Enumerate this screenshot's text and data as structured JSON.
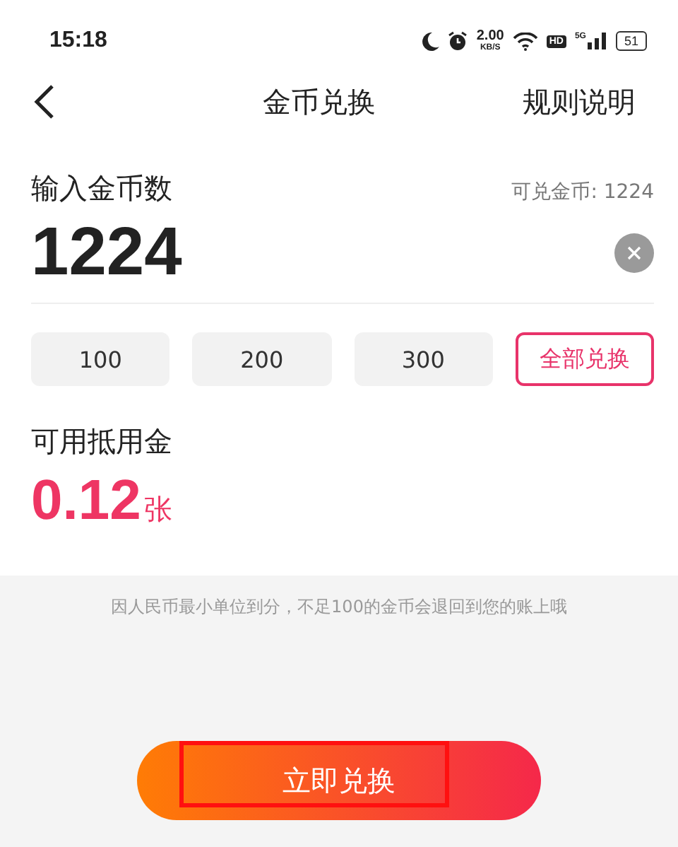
{
  "status_bar": {
    "time": "15:18",
    "speed_value": "2.00",
    "speed_unit": "KB/S",
    "hd": "HD",
    "network": "5G",
    "battery": "51"
  },
  "nav": {
    "title": "金币兑换",
    "action": "规则说明"
  },
  "input": {
    "label": "输入金币数",
    "available": "可兑金币: 1224",
    "value": "1224"
  },
  "chips": [
    {
      "label": "100",
      "selected": false
    },
    {
      "label": "200",
      "selected": false
    },
    {
      "label": "300",
      "selected": false
    },
    {
      "label": "全部兑换",
      "selected": true
    }
  ],
  "result": {
    "label": "可用抵用金",
    "amount": "0.12",
    "unit": "张"
  },
  "hint": "因人民币最小单位到分，不足100的金币会退回到您的账上哦",
  "submit": "立即兑换"
}
